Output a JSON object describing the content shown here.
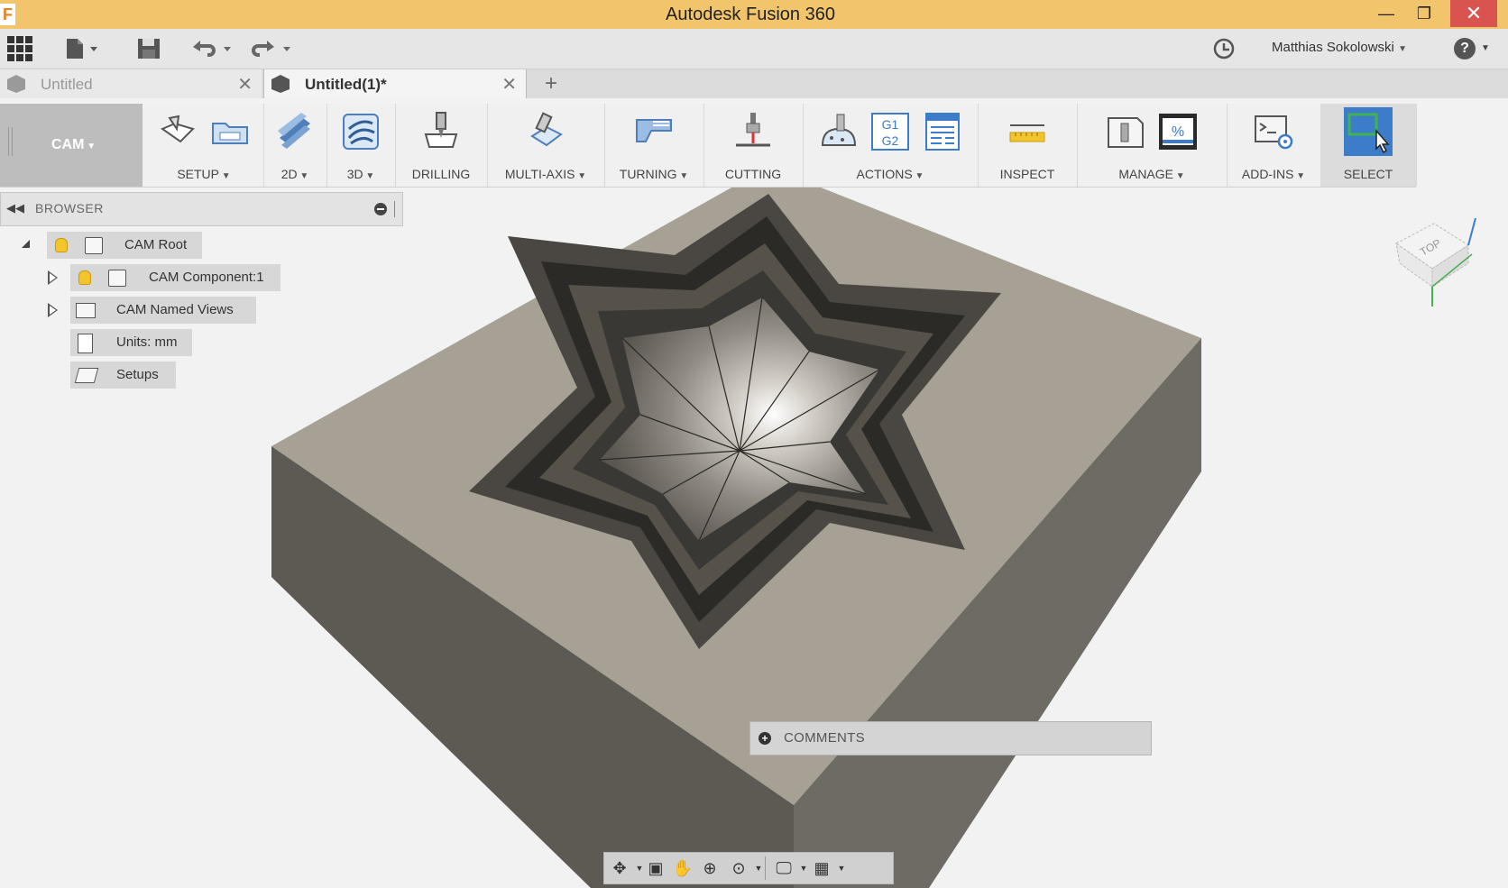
{
  "window": {
    "title": "Autodesk Fusion 360",
    "logo_letter": "F",
    "min_symbol": "—",
    "max_symbol": "❐",
    "close_symbol": "✕"
  },
  "quick_access": {
    "user_name": "Matthias Sokolowski",
    "help_symbol": "?"
  },
  "tabs": [
    {
      "label": "Untitled",
      "active": false
    },
    {
      "label": "Untitled(1)*",
      "active": true
    }
  ],
  "tab_close_symbol": "✕",
  "new_tab_symbol": "+",
  "ribbon": {
    "workspace": "CAM",
    "groups": [
      {
        "label": "SETUP",
        "dropdown": true
      },
      {
        "label": "2D",
        "dropdown": true
      },
      {
        "label": "3D",
        "dropdown": true
      },
      {
        "label": "DRILLING",
        "dropdown": false
      },
      {
        "label": "MULTI-AXIS",
        "dropdown": true
      },
      {
        "label": "TURNING",
        "dropdown": true
      },
      {
        "label": "CUTTING",
        "dropdown": false
      },
      {
        "label": "ACTIONS",
        "dropdown": true
      },
      {
        "label": "INSPECT",
        "dropdown": false
      },
      {
        "label": "MANAGE",
        "dropdown": true
      },
      {
        "label": "ADD-INS",
        "dropdown": true
      },
      {
        "label": "SELECT",
        "dropdown": false
      }
    ],
    "actions_gcode_text": [
      "G1",
      "G2"
    ],
    "manage_percent": "%"
  },
  "browser": {
    "title": "BROWSER",
    "items": [
      {
        "label": "CAM Root",
        "icon": "component-icon"
      },
      {
        "label": "CAM Component:1",
        "icon": "component-icon"
      },
      {
        "label": "CAM Named Views",
        "icon": "folder-icon"
      },
      {
        "label": "Units: mm",
        "icon": "document-icon"
      },
      {
        "label": "Setups",
        "icon": "setup-icon"
      }
    ]
  },
  "viewcube": {
    "face_label": "TOP",
    "axis_colors": {
      "x": "#3a7bd5",
      "y": "#4caf50",
      "z": "#3a7bd5"
    }
  },
  "comments": {
    "label": "COMMENTS"
  },
  "colors": {
    "titlebar": "#f2c46c",
    "select_active": "#3d7cc9",
    "close_button": "#d9534f"
  }
}
